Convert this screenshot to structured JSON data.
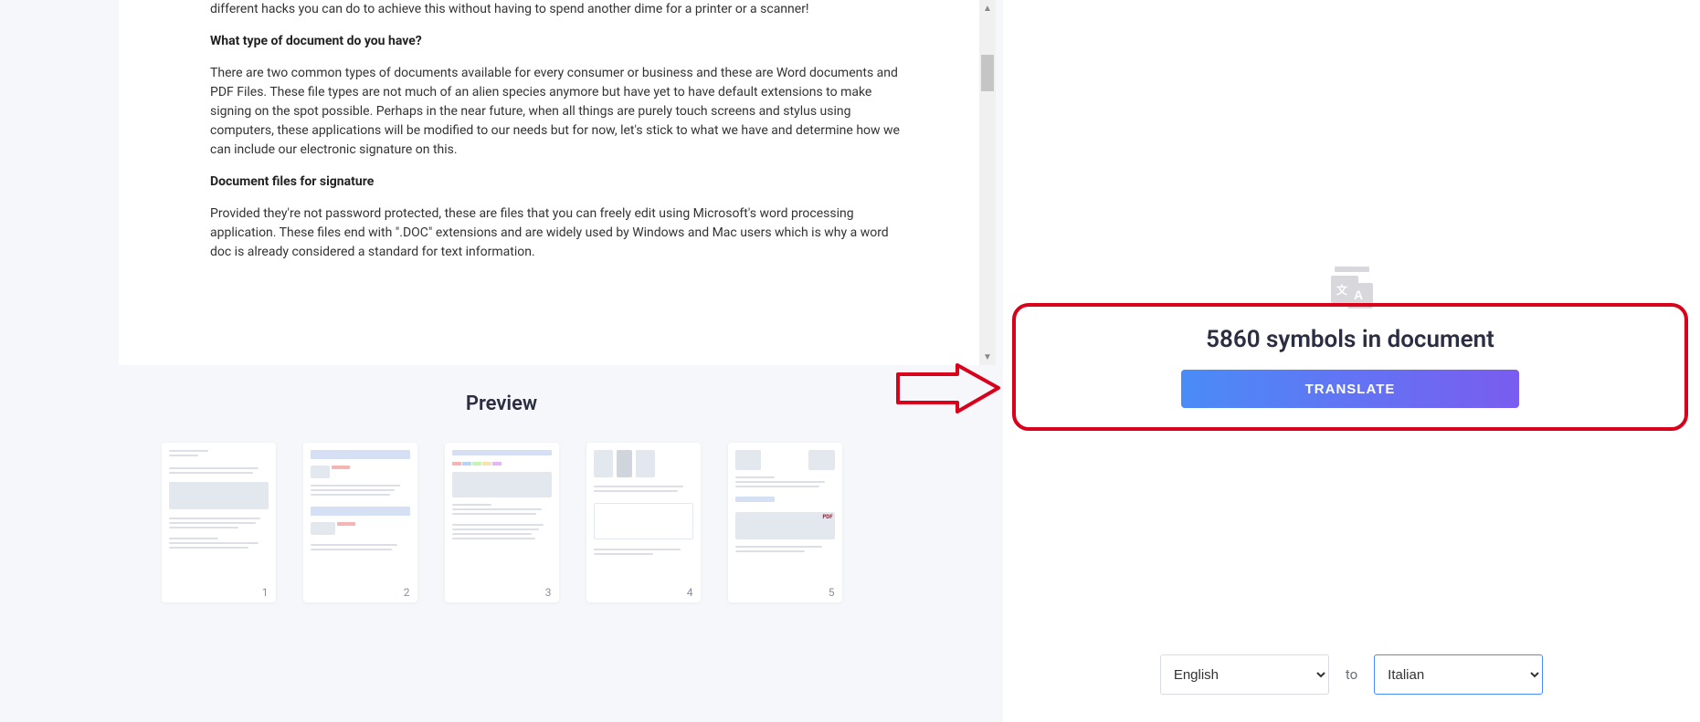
{
  "document": {
    "intro_tail": "different hacks you can do to achieve this without having to spend another dime for a printer or a scanner!",
    "heading1": "What type of document do you have?",
    "para1": "There are two common types of documents available for every consumer or business and these are Word documents and PDF Files. These file types are not much of an alien species anymore but have yet to have default extensions to make signing on the spot possible. Perhaps in the near future, when all things are purely touch screens and stylus using computers, these applications will be modified to our needs but for now, let's stick to what we have and determine how we can include our electronic signature on this.",
    "heading2": "Document files for signature",
    "para2": "Provided they're not password protected, these are files that you can freely edit using Microsoft's word processing application. These files end with \".DOC\" extensions and are widely used by Windows and Mac users which is why a word doc is already considered a standard for text information."
  },
  "preview": {
    "title": "Preview",
    "pages": [
      "1",
      "2",
      "3",
      "4",
      "5"
    ]
  },
  "translate": {
    "symbols_text": "5860 symbols in document",
    "button_label": "TRANSLATE",
    "to_label": "to",
    "source_lang": "English",
    "target_lang": "Italian"
  }
}
